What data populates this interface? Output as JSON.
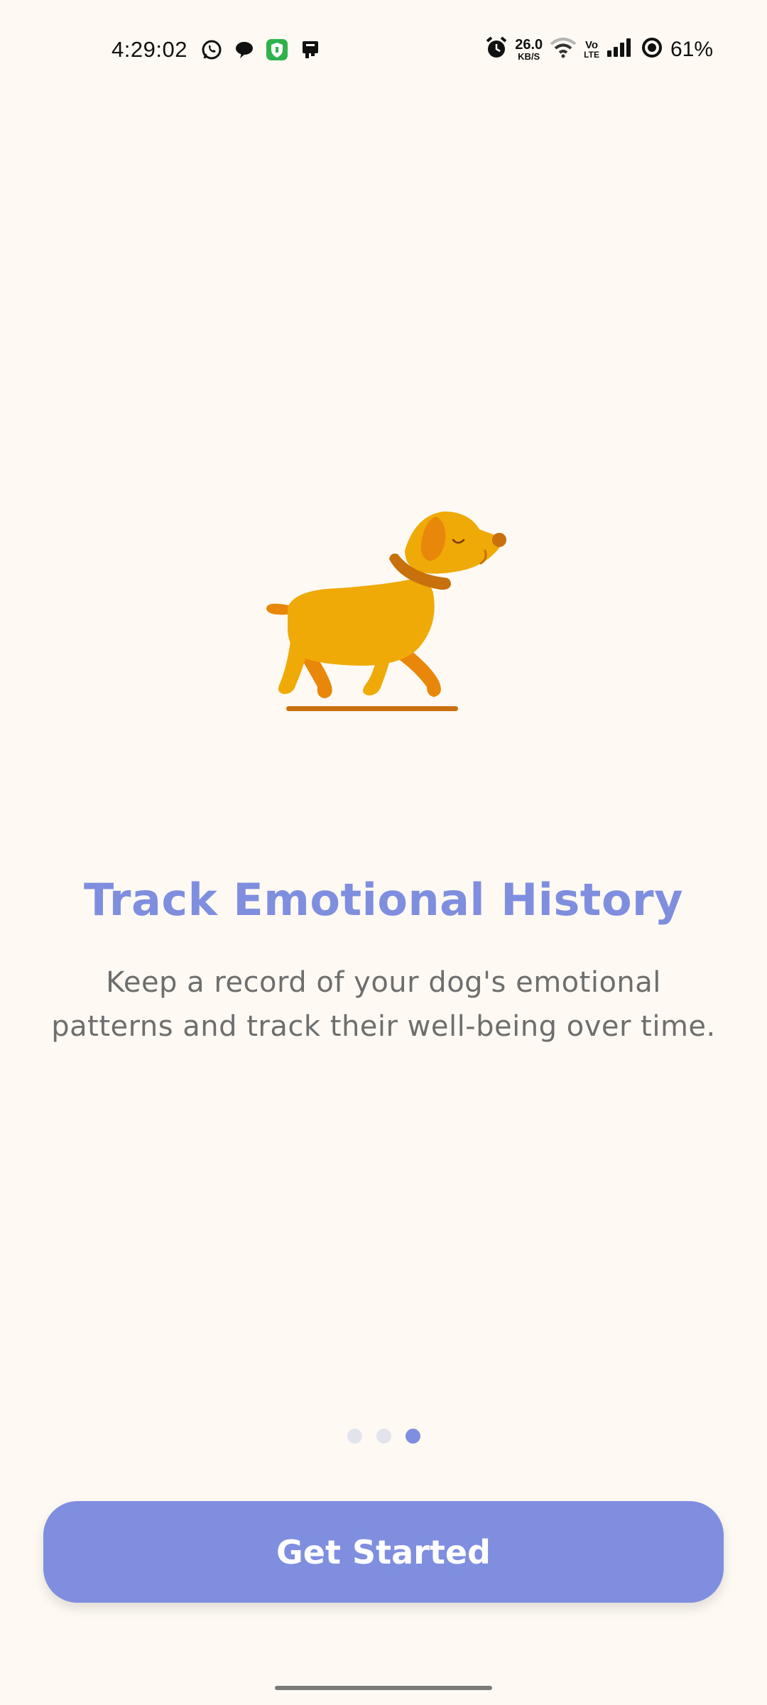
{
  "status_bar": {
    "time": "4:29:02",
    "left_icons": [
      "whatsapp-icon",
      "chat-bubble-icon",
      "shield-app-icon",
      "card-app-icon"
    ],
    "net_speed_value": "26.0",
    "net_speed_unit": "KB/S",
    "volte_top": "Vo",
    "volte_bottom": "LTE",
    "battery_percent": "61%",
    "right_icons": [
      "alarm-icon",
      "wifi-icon",
      "volte-icon",
      "signal-icon",
      "battery-ring-icon"
    ]
  },
  "onboarding": {
    "illustration": "walking-dog-illustration",
    "title": "Track Emotional History",
    "description": "Keep a record of your dog's emotional patterns and track their well-being over time.",
    "page_count": 3,
    "active_page": 3,
    "cta_label": "Get Started"
  },
  "colors": {
    "background": "#FEFAF3",
    "accent": "#7F8EDE",
    "dot_inactive": "#E3E3EE",
    "dog_body": "#F0AA07",
    "dog_accent": "#E8870A",
    "dog_collar": "#C8700C",
    "text_secondary": "#6E6E6E"
  }
}
